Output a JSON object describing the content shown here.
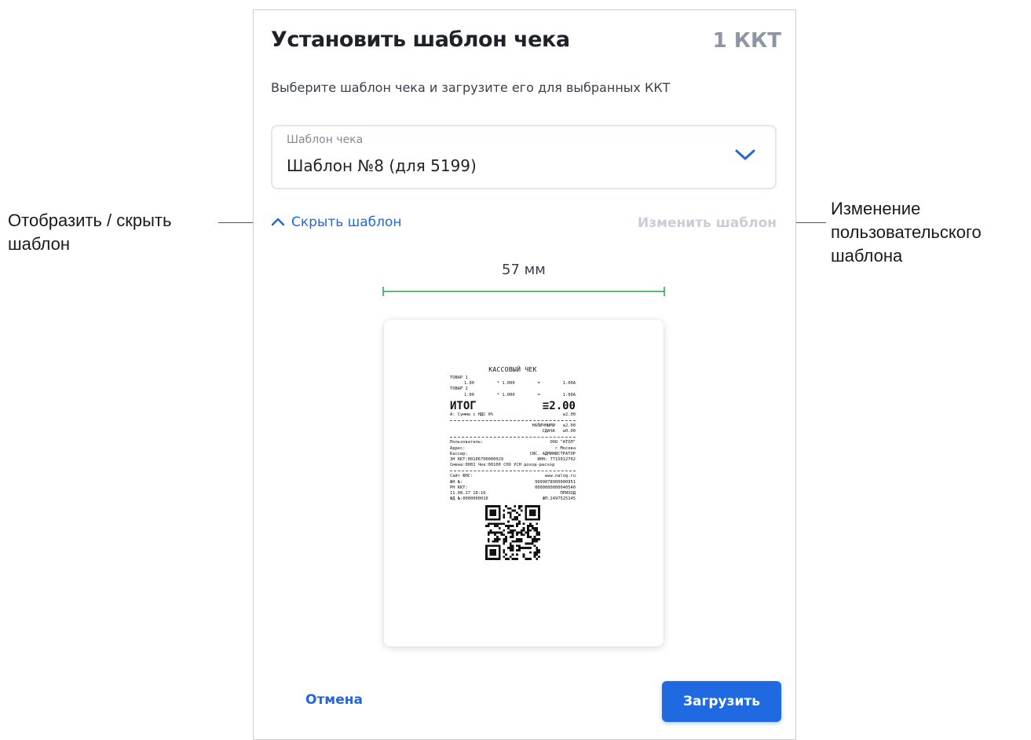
{
  "annotations": {
    "left_callout": [
      "Отобразить / скрыть",
      "шаблон"
    ],
    "right_callout": [
      "Изменение",
      "пользовательского",
      "шаблона"
    ]
  },
  "dialog": {
    "title": "Установить шаблон чека",
    "device_count": "1 ККТ",
    "subtitle": "Выберите шаблон чека и загрузите его для выбранных ККТ",
    "template_select": {
      "label": "Шаблон чека",
      "value": "Шаблон №8 (для 5199)",
      "icon": "chevron-down-icon"
    },
    "toggle_label": "Скрыть шаблон",
    "toggle_icon": "chevron-up-icon",
    "edit_label": "Изменить шаблон",
    "ruler_label": "57 мм",
    "cancel_label": "Отмена",
    "upload_label": "Загрузить"
  },
  "receipt": {
    "title": "КАССОВЫЙ ЧЕК",
    "items": [
      {
        "name": "ТОВАР 1",
        "qty": "1.00",
        "x": "* 1.000",
        "eq": "=",
        "sum": "1.00А"
      },
      {
        "name": "ТОВАР 2",
        "qty": "1.00",
        "x": "* 1.000",
        "eq": "=",
        "sum": "1.00А"
      }
    ],
    "total_label": "ИТОГ",
    "total_value": "≡2.00",
    "vat_label": "А: Сумма с НДС 0%",
    "vat_value": "≡2.00",
    "payments": [
      {
        "label": "НАЛИЧНЫМИ",
        "value": "≡2.00"
      },
      {
        "label": "СДАЧА",
        "value": "≡0.00"
      }
    ],
    "info_rows": [
      {
        "l": "Пользователь:",
        "r": "ООО \"АТОЛ\""
      },
      {
        "l": "Адрес:",
        "r": "г Москва"
      },
      {
        "l": "Кассир:",
        "r": "СИС. АДМИНИСТРАТОР"
      },
      {
        "l": "ЗН ККТ:00106700000029",
        "r": "ИНН: 7715012702"
      },
      {
        "l": "Смена:0001  Чек:00100 СНО УСН доход-расход",
        "r": ""
      }
    ],
    "fiscal_rows": [
      {
        "l": "Сайт ФНС:",
        "r": "www.nalog.ru"
      },
      {
        "l": "ФН №:",
        "r": "9999078900000951"
      },
      {
        "l": "РН ККТ:",
        "r": "0000000000040540"
      },
      {
        "l": "11.08.17 18:16",
        "r": "ПРИХОД"
      },
      {
        "l": "ФД №:0000000010",
        "r": "ФП:2497525145"
      }
    ]
  }
}
